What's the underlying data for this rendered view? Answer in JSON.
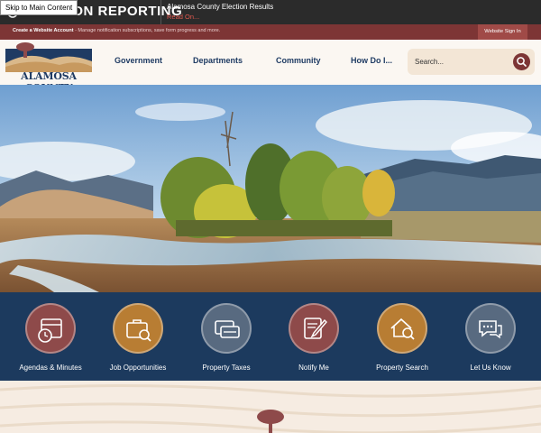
{
  "alert": {
    "title": "ELECTION REPORTING",
    "message": "Alamosa County Election Results",
    "link": "Read On..."
  },
  "skip_link": "Skip to Main Content",
  "account_bar": {
    "strong": "Create a Website Account",
    "text": " - Manage notification subscriptions, save form progress and more.",
    "sign_in": "Website Sign In"
  },
  "logo": {
    "text": "ALAMOSA COUNTY"
  },
  "nav": {
    "items": [
      "Government",
      "Departments",
      "Community",
      "How Do I..."
    ]
  },
  "search": {
    "placeholder": "Search..."
  },
  "quick_links": [
    {
      "label": "Agendas & Minutes",
      "icon": "calendar-clock-icon",
      "color": "#8e4a4a"
    },
    {
      "label": "Job Opportunities",
      "icon": "briefcase-search-icon",
      "color": "#b87d33"
    },
    {
      "label": "Property Taxes",
      "icon": "money-card-icon",
      "color": "#586a80"
    },
    {
      "label": "Notify Me",
      "icon": "notepad-pen-icon",
      "color": "#8e4a4a"
    },
    {
      "label": "Property Search",
      "icon": "house-search-icon",
      "color": "#b87d33"
    },
    {
      "label": "Let Us Know",
      "icon": "chat-bubbles-icon",
      "color": "#586a80"
    }
  ],
  "colors": {
    "accent": "#7d3535",
    "navy": "#1c3a5e",
    "gold": "#b87d33",
    "slate": "#586a80"
  }
}
